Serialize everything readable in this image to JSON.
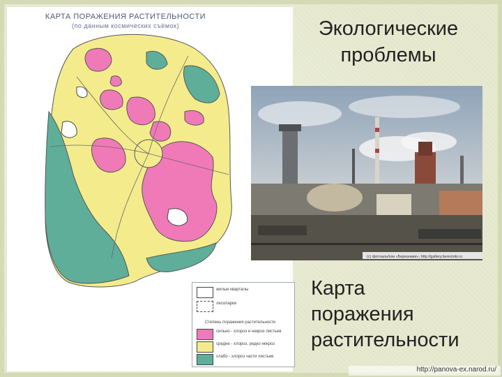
{
  "slide": {
    "title_line1": "Экологические",
    "title_line2": "проблемы",
    "caption_line1": "Карта",
    "caption_line2": "поражения",
    "caption_line3": "растительности",
    "footer_url": "http://panova-ex.narod.ru/"
  },
  "map": {
    "title": "КАРТА ПОРАЖЕНИЯ РАСТИТЕЛЬНОСТИ",
    "subtitle": "(по данным космических съёмок)"
  },
  "legend": {
    "items": [
      {
        "label": "жилые кварталы"
      },
      {
        "label": "лесопарки"
      }
    ],
    "heading": "Степень поражения растительности",
    "levels": [
      {
        "label": "сильно - хлороз и некроз листьев",
        "color": "#f07ab8"
      },
      {
        "label": "средне - хлороз, редко некроз",
        "color": "#f4ec8c"
      },
      {
        "label": "слабо - хлороз части листьев",
        "color": "#5fae9a"
      }
    ]
  },
  "photo": {
    "credit": "(c) фотоальбом «Березники», http://gallery.berezniki.ru"
  },
  "colors": {
    "strong": "#f07ab8",
    "medium": "#f4ec8c",
    "weak": "#5fae9a",
    "background": "#e7ead0"
  }
}
